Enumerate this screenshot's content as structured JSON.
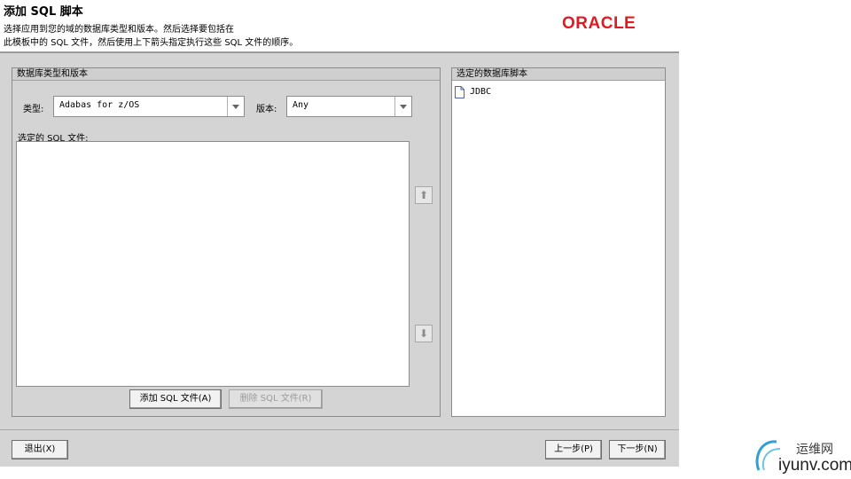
{
  "header": {
    "title": "添加 SQL 脚本",
    "desc_line1": "选择应用到您的域的数据库类型和版本。然后选择要包括在",
    "desc_line2": "此模板中的 SQL 文件，然后使用上下箭头指定执行这些 SQL 文件的顺序。",
    "logo": "ORACLE",
    "logo_color": "#e01b22"
  },
  "db_panel": {
    "title": "数据库类型和版本",
    "type_label": "类型:",
    "type_value": "Adabas for z/OS",
    "version_label": "版本:",
    "version_value": "Any",
    "selected_sql_label": "选定的 SQL 文件:",
    "add_button": "添加 SQL 文件(A)",
    "remove_button": "删除 SQL 文件(R)"
  },
  "scripts_panel": {
    "title": "选定的数据库脚本",
    "items": [
      {
        "label": "JDBC",
        "icon": "document-icon"
      }
    ]
  },
  "footer": {
    "exit_button": "退出(X)",
    "prev_button": "上一步(P)",
    "next_button": "下一步(N)"
  },
  "watermark": {
    "name": "运维网",
    "url": "iyunv.com"
  }
}
